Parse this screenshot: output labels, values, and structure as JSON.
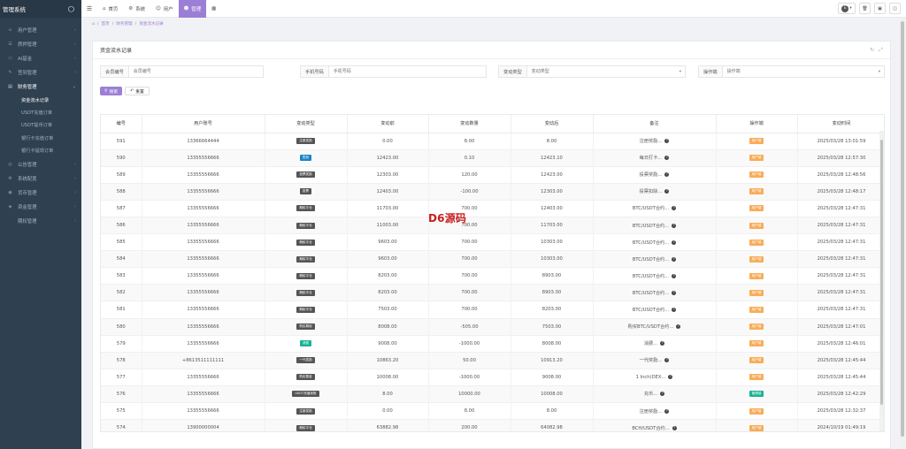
{
  "brand": {
    "title": "管理系统",
    "icon": "bell-icon"
  },
  "sidebar": {
    "items": [
      {
        "label": "用户管理",
        "icon": "home-icon",
        "open": false
      },
      {
        "label": "质押管理",
        "icon": "list-icon",
        "open": false
      },
      {
        "label": "AI基金",
        "icon": "monitor-icon",
        "open": false
      },
      {
        "label": "签到管理",
        "icon": "edit-icon",
        "open": false
      },
      {
        "label": "财务管理",
        "icon": "card-icon",
        "open": true
      }
    ],
    "sub_items": [
      "资金流水记录",
      "USDT充值订单",
      "USDT提币订单",
      "银行卡充值订单",
      "银行卡提现订单"
    ],
    "items2": [
      {
        "label": "公告管理",
        "icon": "globe-icon"
      },
      {
        "label": "系统配置",
        "icon": "gear-icon"
      },
      {
        "label": "货币管理",
        "icon": "coin-icon"
      },
      {
        "label": "资金管理",
        "icon": "wallet-icon"
      },
      {
        "label": "期权管理",
        "icon": ""
      }
    ]
  },
  "topbar": {
    "tabs": [
      {
        "label": "首页",
        "icon": "home-icon"
      },
      {
        "label": "系统",
        "icon": "gear-icon"
      },
      {
        "label": "用户",
        "icon": "user-icon"
      },
      {
        "label": "管理",
        "icon": "user-group-icon"
      }
    ],
    "active_tab": "管理",
    "avatar_letter": "E"
  },
  "breadcrumb": [
    "首页",
    "财务管理",
    "资金流水记录"
  ],
  "panel": {
    "title": "资金流水记录"
  },
  "filters": {
    "member_no": {
      "label": "会员编号",
      "placeholder": "会员编号"
    },
    "phone": {
      "label": "手机号码",
      "placeholder": "手机号码"
    },
    "change_type": {
      "label": "变动类型",
      "placeholder": "变动类型"
    },
    "operator": {
      "label": "操作端",
      "placeholder": "操作端"
    }
  },
  "buttons": {
    "search": "搜索",
    "reset": "重置"
  },
  "table": {
    "columns": [
      "编号",
      "用户账号",
      "变动类型",
      "变动前",
      "变动数量",
      "变动后",
      "备注",
      "操作端",
      "变动时间"
    ],
    "rows": [
      {
        "id": "591",
        "account": "13366664444",
        "type": "注册奖励",
        "type_color": "dark",
        "before": "0.00",
        "amount": "8.00",
        "after": "8.00",
        "remark": "注册奖励...",
        "op": "用户端",
        "op_color": "orange",
        "time": "2025/03/28 13:01:59"
      },
      {
        "id": "590",
        "account": "13355556666",
        "type": "签到",
        "type_color": "blue",
        "before": "12423.00",
        "amount": "0.10",
        "after": "12423.10",
        "remark": "每日打卡...",
        "op": "用户端",
        "op_color": "orange",
        "time": "2025/03/28 12:57:30"
      },
      {
        "id": "589",
        "account": "13355556666",
        "type": "投票奖励",
        "type_color": "dark",
        "before": "12303.00",
        "amount": "120.00",
        "after": "12423.00",
        "remark": "投票奖励...",
        "op": "用户端",
        "op_color": "orange",
        "time": "2025/03/28 12:48:56"
      },
      {
        "id": "588",
        "account": "13355556666",
        "type": "投票",
        "type_color": "dark",
        "before": "12403.00",
        "amount": "-100.00",
        "after": "12303.00",
        "remark": "投票扣除...",
        "op": "用户端",
        "op_color": "orange",
        "time": "2025/03/28 12:48:17"
      },
      {
        "id": "587",
        "account": "13355556666",
        "type": "期权平仓",
        "type_color": "dark",
        "before": "11703.00",
        "amount": "700.00",
        "after": "12403.00",
        "remark": "BTC/USDT合约...",
        "op": "用户端",
        "op_color": "orange",
        "time": "2025/03/28 12:47:31"
      },
      {
        "id": "586",
        "account": "13355556666",
        "type": "期权平仓",
        "type_color": "dark",
        "before": "11003.00",
        "amount": "700.00",
        "after": "11703.00",
        "remark": "BTC/USDT合约...",
        "op": "用户端",
        "op_color": "orange",
        "time": "2025/03/28 12:47:31"
      },
      {
        "id": "585",
        "account": "13355556666",
        "type": "期权平仓",
        "type_color": "dark",
        "before": "9603.00",
        "amount": "700.00",
        "after": "10303.00",
        "remark": "BTC/USDT合约...",
        "op": "用户端",
        "op_color": "orange",
        "time": "2025/03/28 12:47:31"
      },
      {
        "id": "584",
        "account": "13355556666",
        "type": "期权平仓",
        "type_color": "dark",
        "before": "9603.00",
        "amount": "700.00",
        "after": "10303.00",
        "remark": "BTC/USDT合约...",
        "op": "用户端",
        "op_color": "orange",
        "time": "2025/03/28 12:47:31"
      },
      {
        "id": "583",
        "account": "13355556666",
        "type": "期权平仓",
        "type_color": "dark",
        "before": "8203.00",
        "amount": "700.00",
        "after": "8903.00",
        "remark": "BTC/USDT合约...",
        "op": "用户端",
        "op_color": "orange",
        "time": "2025/03/28 12:47:31"
      },
      {
        "id": "582",
        "account": "13355556666",
        "type": "期权平仓",
        "type_color": "dark",
        "before": "8203.00",
        "amount": "700.00",
        "after": "8903.00",
        "remark": "BTC/USDT合约...",
        "op": "用户端",
        "op_color": "orange",
        "time": "2025/03/28 12:47:31"
      },
      {
        "id": "581",
        "account": "13355556666",
        "type": "期权平仓",
        "type_color": "dark",
        "before": "7503.00",
        "amount": "700.00",
        "after": "8203.00",
        "remark": "BTC/USDT合约...",
        "op": "用户端",
        "op_color": "orange",
        "time": "2025/03/28 12:47:31"
      },
      {
        "id": "580",
        "account": "13355556666",
        "type": "购买期权",
        "type_color": "dark",
        "before": "8008.00",
        "amount": "-505.00",
        "after": "7503.00",
        "remark": "购买BTC/USDT合约...",
        "op": "用户端",
        "op_color": "orange",
        "time": "2025/03/28 12:47:01"
      },
      {
        "id": "579",
        "account": "13355556666",
        "type": "消费",
        "type_color": "green",
        "before": "9008.00",
        "amount": "-1000.00",
        "after": "8008.00",
        "remark": "消费...",
        "op": "用户端",
        "op_color": "orange",
        "time": "2025/03/28 12:46:01"
      },
      {
        "id": "578",
        "account": "+8613511111111",
        "type": "一代奖励",
        "type_color": "dark",
        "before": "10863.20",
        "amount": "50.00",
        "after": "10913.20",
        "remark": "一代奖励...",
        "op": "用户端",
        "op_color": "orange",
        "time": "2025/03/28 12:45:44"
      },
      {
        "id": "577",
        "account": "13355556666",
        "type": "购买基金",
        "type_color": "dark",
        "before": "10008.00",
        "amount": "-1000.00",
        "after": "9008.00",
        "remark": "1 Inch(DEX...",
        "op": "用户端",
        "op_color": "orange",
        "time": "2025/03/28 12:45:44"
      },
      {
        "id": "576",
        "account": "13355556666",
        "type": "USDT充值到账",
        "type_color": "dark",
        "before": "8.00",
        "amount": "10000.00",
        "after": "10008.00",
        "remark": "充币...",
        "op": "管理端",
        "op_color": "green",
        "time": "2025/03/28 12:42:29"
      },
      {
        "id": "575",
        "account": "13355556666",
        "type": "注册奖励",
        "type_color": "dark",
        "before": "0.00",
        "amount": "8.00",
        "after": "8.00",
        "remark": "注册奖励...",
        "op": "用户端",
        "op_color": "orange",
        "time": "2025/03/28 12:32:37"
      },
      {
        "id": "574",
        "account": "13900000004",
        "type": "期权平仓",
        "type_color": "dark",
        "before": "63882.98",
        "amount": "200.00",
        "after": "64082.98",
        "remark": "BCH/USDT合约...",
        "op": "用户端",
        "op_color": "orange",
        "time": "2024/10/19 01:49:19"
      }
    ]
  },
  "watermark": "D6源码"
}
